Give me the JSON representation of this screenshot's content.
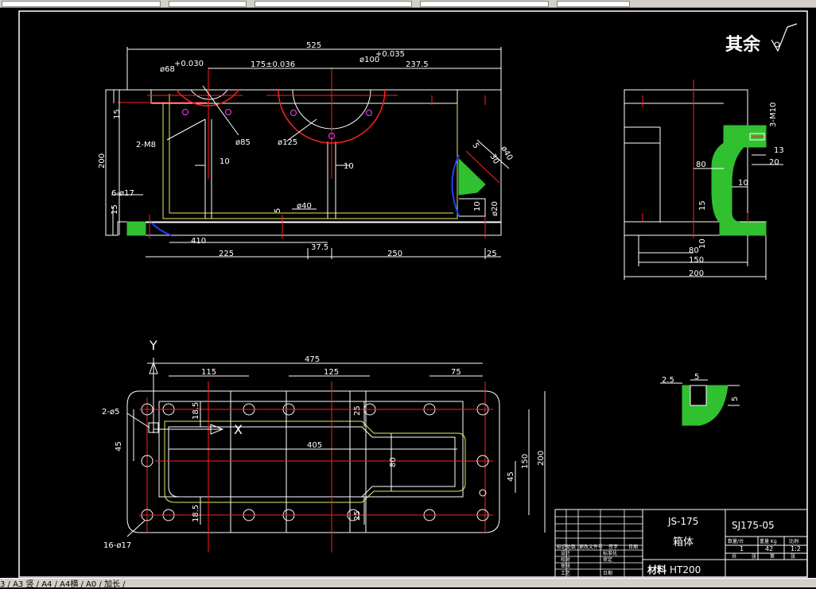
{
  "surface_note": {
    "symbol": "其余"
  },
  "front_view": {
    "dims": {
      "overall_length": "525",
      "bore1": "ø68",
      "bore1_tol": "+0.030",
      "bore_spacing": "175±0.036",
      "bore2": "ø100",
      "bore2_tol": "+0.035",
      "right_len": "237.5",
      "height_15": "15",
      "height_200": "200",
      "thread_2m8": "2-M8",
      "circle_85": "ø85",
      "circle_125": "ø125",
      "wall_10a": "10",
      "wall_10b": "10",
      "holes_6": "6-ø17",
      "base_15": "15",
      "gap_5": "5",
      "slot_40": "ø40",
      "len_410": "410",
      "len_225": "225",
      "len_37_5": "37.5",
      "len_250": "250",
      "len_25": "25",
      "side_5": "5",
      "side_30": "30",
      "side_40": "ø40",
      "side_10": "10",
      "side_20": "ø20"
    }
  },
  "side_view": {
    "dims": {
      "thread": "3-M10",
      "d13": "13",
      "d20": "20",
      "d80a": "80",
      "d10": "10",
      "d15": "15",
      "d10b": "10",
      "d80b": "80",
      "d150": "150",
      "d200": "200"
    }
  },
  "top_view": {
    "dims": {
      "axis_y": "Y",
      "axis_x": "X",
      "len_475": "475",
      "len_115": "115",
      "len_125": "125",
      "len_75": "75",
      "holes_2": "2-ø5",
      "d18_5a": "18.5",
      "d25a": "25",
      "d45a": "45",
      "len_405": "405",
      "d80": "80",
      "d45b": "45",
      "d150": "150",
      "d200": "200",
      "d18_5b": "18.5",
      "d25b": "25",
      "holes_16": "16-ø17"
    }
  },
  "detail": {
    "d2_5": "2.5",
    "d5a": "5",
    "d5b": "5"
  },
  "title_block": {
    "model": "JS-175",
    "drawing_no": "SJ175-05",
    "part_name": "箱体",
    "material_label": "材料",
    "material": "HT200",
    "qty_label": "数量/台",
    "weight_label": "重量 Kg",
    "scale_label": "比例",
    "qty": "1",
    "weight": "42",
    "scale": "1:2",
    "sheet_total": "共",
    "sheet_word": "张",
    "sheet_no": "第",
    "sheet_word2": "张",
    "r_design": "设计",
    "r_check": "校对",
    "r_review": "审核",
    "r_process": "工艺",
    "c_std": "标准化",
    "c_approve": "审定",
    "c_date": "日期",
    "h1": "标记处数",
    "h2": "更改文件号",
    "h3": "签字",
    "h4": "日期"
  },
  "status_bar": {
    "text": "3 / A3 竖 / A4 / A4横 / A0 / 加长 /"
  },
  "colors": {
    "red": "#ff2020",
    "yellow": "#e8e860",
    "green": "#30c030",
    "blue": "#2040ff",
    "magenta": "#ff40ff"
  }
}
